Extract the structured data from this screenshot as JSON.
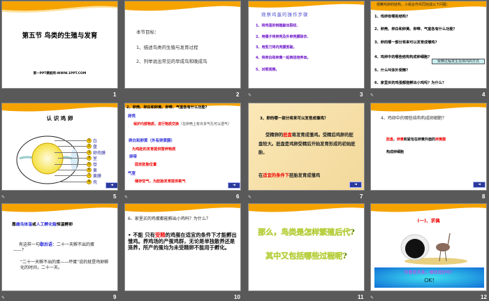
{
  "slides": [
    {
      "number": "1",
      "title": "第五节  鸟类的生殖与发育",
      "footer": "第一PPT模板网-WWW.1PPT.COM"
    },
    {
      "number": "2",
      "heading": "本节目标：",
      "items": [
        "1、描述鸟类的生殖与发育过程",
        "2、列举说出常见的早成鸟和晚成鸟"
      ]
    },
    {
      "number": "3",
      "heading": "观察鸡蛋的操作步骤",
      "items": [
        "1、将鸡蛋的钝端敲出裂纹.",
        "2、用镊子将卵壳及外卵壳膜除去.",
        "3、用剪刀将内壳膜剪破。",
        "4、将卵白和卵黄一起倒进培养皿。",
        "5、对照观察。"
      ]
    },
    {
      "number": "4",
      "header": "观察鸡卵的结构，小组合作共同完成以下问题：",
      "items": [
        "1、鸡卵有哪些结构?",
        "2、卵壳、卵白和卵黄、卵带、气室各有什么功能？",
        "3、卵的哪一部分将来可以发育成雏鸡?",
        "4、鸡卵中的哪些结构构成卵细胞?",
        "5、什么叫体外受精?",
        "6、家里买的鸡蛋都能孵出小鸡吗？为什么？"
      ],
      "callout": "受精过程发生在体内的方式"
    },
    {
      "number": "5",
      "title": "认 识 鸡 卵",
      "labels": [
        "白",
        "盘",
        "卵壳膜",
        "室",
        "带",
        "黄",
        "黄膜",
        "壳"
      ],
      "circles": [
        "1",
        "2",
        "3",
        "4",
        "5",
        "6",
        "7",
        "8"
      ],
      "nav": "◄"
    },
    {
      "number": "6",
      "header": "2、卵壳、卵白和卵黄、卵带、气室各有什么功能?",
      "blocks": [
        {
          "term": "卵壳",
          "desc": "保护内部物质，进行物质交换",
          "extra": "（在卵壳上有许多气孔可以透气）"
        },
        {
          "term": "卵白和卵黄（外有卵黄膜）",
          "desc": "为鸡胚的发育提供营养物质"
        },
        {
          "term": "卵带",
          "desc": "固定胚胎位置"
        },
        {
          "term": "气室",
          "desc": "储存空气，为胚胎发育提供氧气"
        }
      ],
      "nav": "◄"
    },
    {
      "number": "7",
      "question": "3、卵的哪一部分将来可以发育成雏鸡？",
      "p1": "受精卵的",
      "h1": "胚盘",
      "p2": "将发育成雏鸡。受精后鸡卵的胚盘较大。胚盘是鸡卵受精后开始发育形成的初始胚胎，",
      "p3": "在",
      "h2": "适宜的条件下",
      "p4": "胚胎发育成雏鸡",
      "nav": "◄"
    },
    {
      "number": "8",
      "question": "4、鸡卵中的哪些结构构成卵细胞？",
      "r1": "胚盘",
      "s1": "、",
      "r2": "卵黄",
      "s2": "和紧包在卵黄外面的",
      "r3": "卵黄膜",
      "s3": "构成卵细胞",
      "nav": "◄"
    },
    {
      "number": "9",
      "t1": "靠",
      "b1": "雌鸟体温",
      "t2": "或",
      "b2": "人工孵化箱",
      "t3": "恒温孵卵",
      "p1a": "有这样一句",
      "p1b": "歇后语",
      "p1c": "：二十一天孵不出的蛋——？",
      "p2": "“二十一天孵不出的蛋——坏蛋”说的就是鸡卵孵化的时间，二十一天。"
    },
    {
      "number": "10",
      "q": "6、家里买的鸡蛋都能孵出小鸡吗？为什么？",
      "a1": "不能    只有",
      "ar": "受精",
      "a2": "的鸡蛋在适宜的条件下才能孵出雏鸡。养鸡场的产蛋鸡群，无论是单独散养还是笼养，所产的蛋均为未受精卵不能用于孵化。"
    },
    {
      "number": "11",
      "line1": "那么，鸟类是怎样繁殖后代?",
      "line2": "其中又包括哪些过程呢?"
    },
    {
      "number": "12",
      "title": "(一)、求偶",
      "banner": "你看我多美，嫁给我好吗？",
      "ok": "OK!"
    }
  ],
  "colors": {
    "background": "#595959",
    "accent": "#f5a300"
  }
}
